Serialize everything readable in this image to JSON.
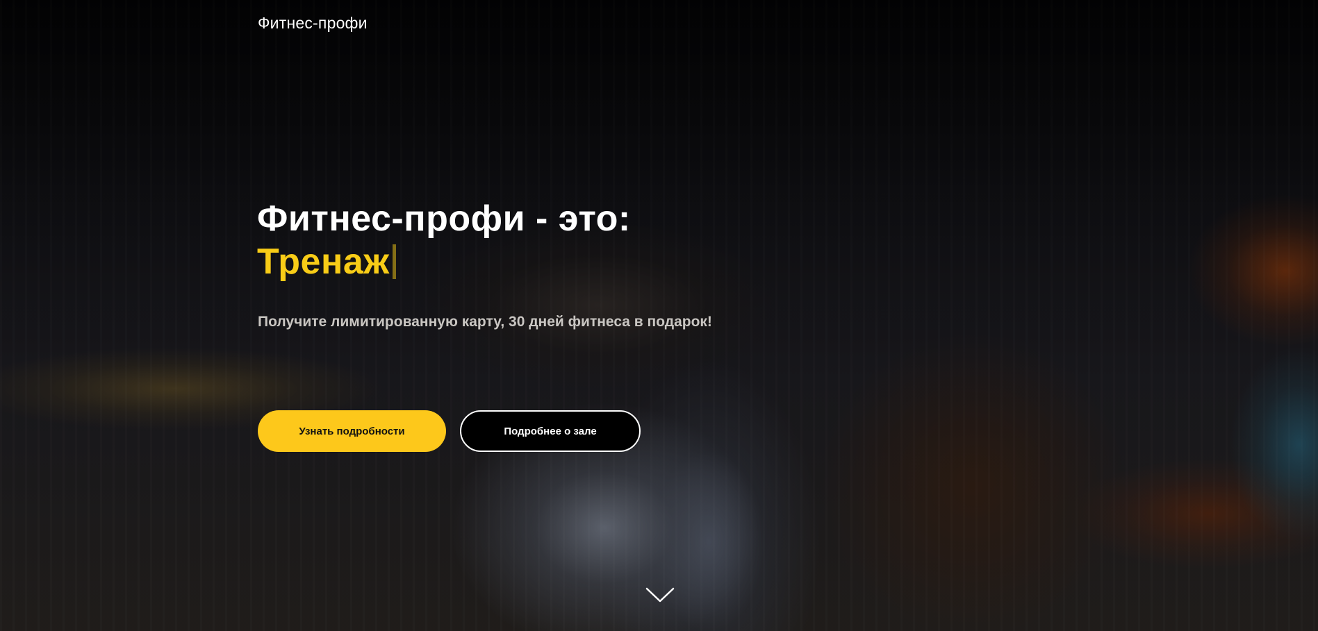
{
  "header": {
    "logo_text": "Фитнес-профи"
  },
  "hero": {
    "headline": "Фитнес-профи - это:",
    "rotating_word": "Тренаж",
    "subtitle": "Получите лимитированную карту, 30 дней фитнеса в подарок!",
    "primary_button_label": "Узнать подробности",
    "secondary_button_label": "Подробнее о зале",
    "scroll_icon": "chevron-down-icon"
  },
  "colors": {
    "accent": "#fdc81b",
    "accent_text": "#f8cc17",
    "text_primary": "#ffffff",
    "text_secondary": "#c9c6c2",
    "button_dark": "#000000"
  }
}
